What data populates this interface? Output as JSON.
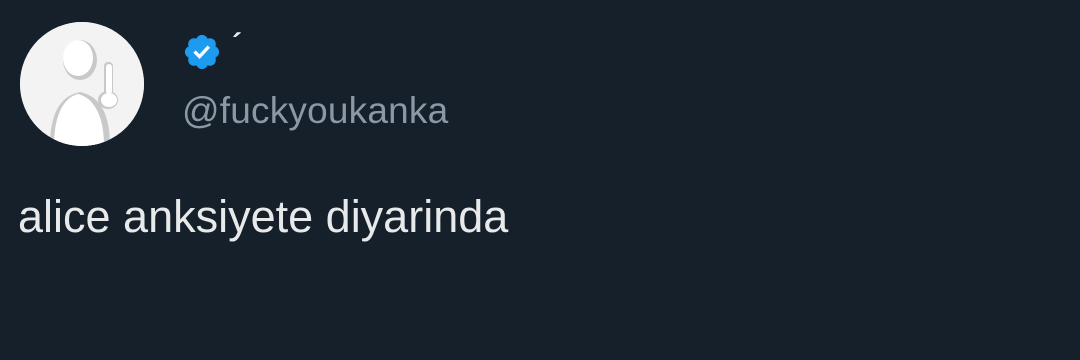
{
  "tweet": {
    "display_name": "´",
    "handle": "@fuckyoukanka",
    "text": "alice anksiyete diyarinda",
    "verified": true
  },
  "icons": {
    "verified": "verified-check-icon",
    "avatar": "user-avatar-silhouette"
  },
  "colors": {
    "background": "#15202b",
    "text_primary": "#e7e9ea",
    "text_secondary": "#8b98a5",
    "verified_blue": "#1d9bf0"
  }
}
